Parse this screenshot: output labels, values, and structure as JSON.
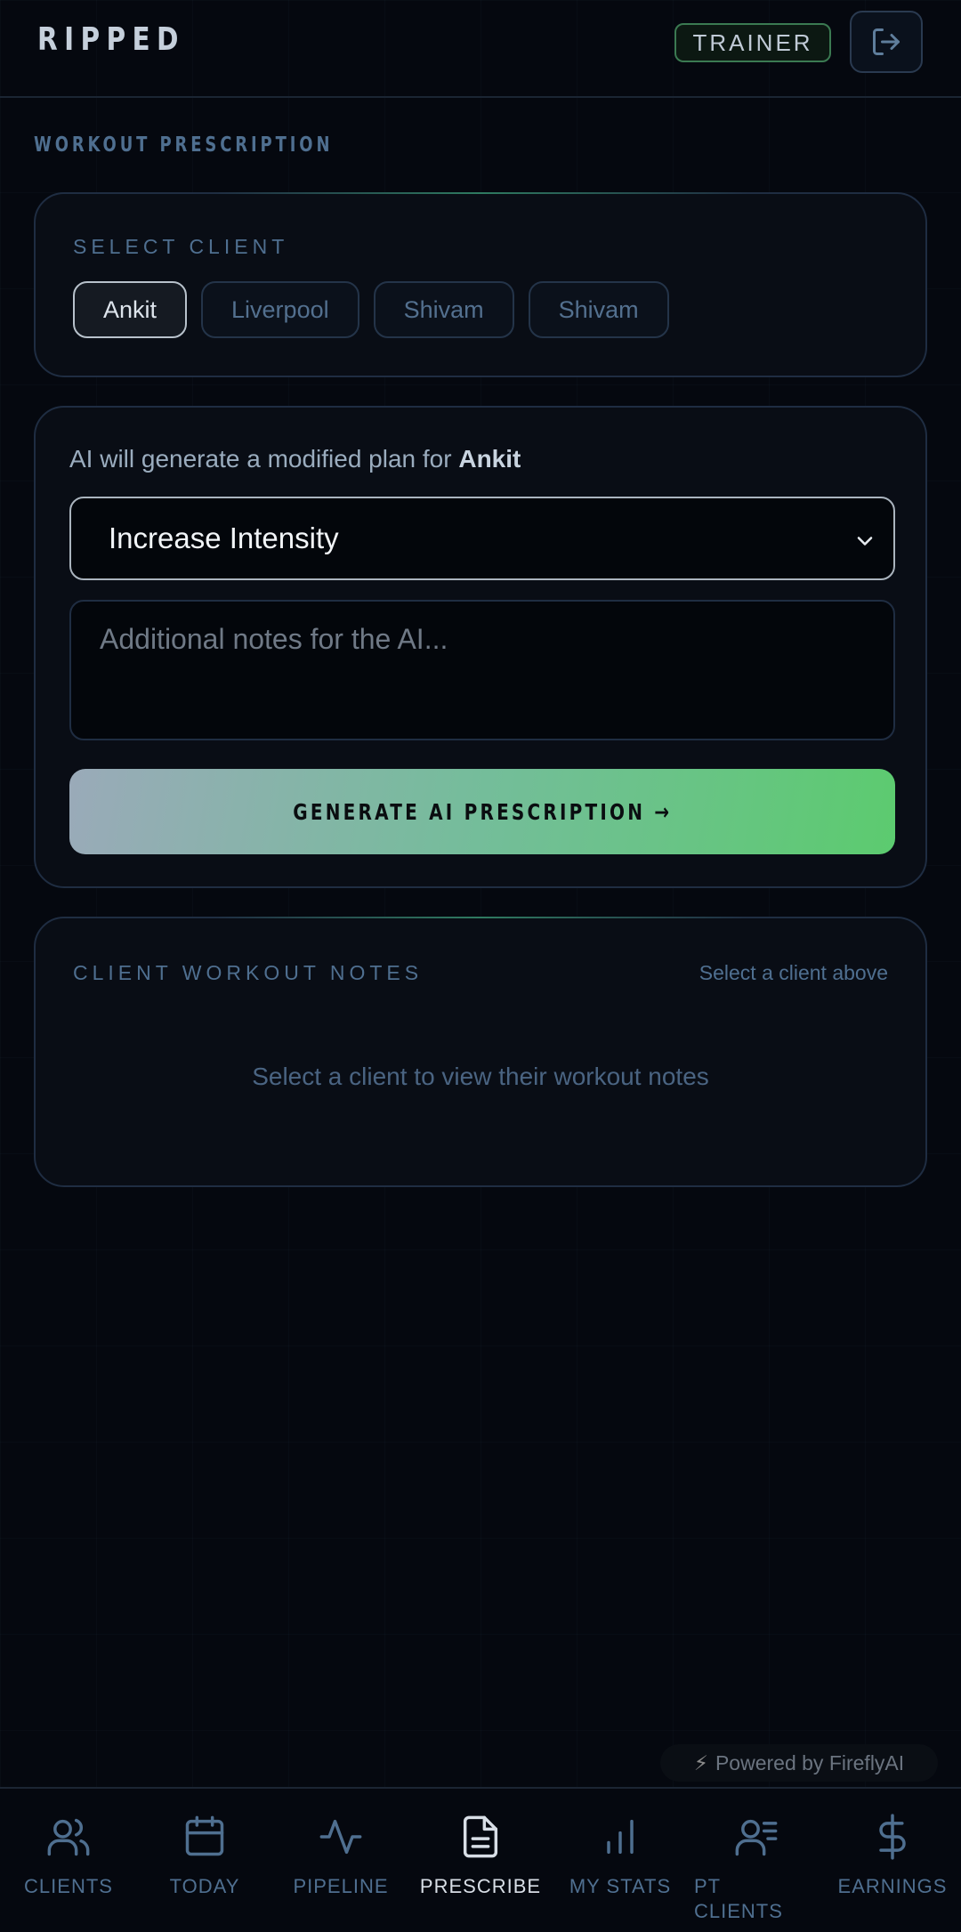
{
  "header": {
    "brand": "RIPPED",
    "role_badge": "TRAINER",
    "logout_icon": "logout-icon"
  },
  "page": {
    "section_title": "WORKOUT PRESCRIPTION"
  },
  "client_select": {
    "label": "SELECT CLIENT",
    "clients": [
      "Ankit",
      "Liverpool",
      "Shivam",
      "Shivam"
    ],
    "selected_index": 0
  },
  "prescription": {
    "ai_prefix": "AI will generate a modified plan for ",
    "client_name": "Ankit",
    "mode_value": "Increase Intensity",
    "notes_placeholder": "Additional notes for the AI...",
    "notes_value": "",
    "generate_label": "GENERATE AI PRESCRIPTION →"
  },
  "workout_notes": {
    "label": "CLIENT WORKOUT NOTES",
    "hint": "Select a client above",
    "empty_text": "Select a client to view their workout notes"
  },
  "powered_by": {
    "icon": "bolt-icon",
    "text": "Powered by FireflyAI"
  },
  "nav": {
    "active": "prescribe",
    "items": [
      {
        "id": "clients",
        "label": "CLIENTS",
        "icon": "users-icon"
      },
      {
        "id": "today",
        "label": "TODAY",
        "icon": "calendar-icon"
      },
      {
        "id": "pipeline",
        "label": "PIPELINE",
        "icon": "activity-icon"
      },
      {
        "id": "prescribe",
        "label": "PRESCRIBE",
        "icon": "file-text-icon"
      },
      {
        "id": "my-stats",
        "label": "MY STATS",
        "icon": "bar-chart-icon"
      },
      {
        "id": "pt-clients",
        "label": "PT CLIENTS",
        "icon": "user-list-icon"
      },
      {
        "id": "earnings",
        "label": "EARNINGS",
        "icon": "dollar-icon"
      }
    ]
  },
  "colors": {
    "background": "#05080f",
    "accent_green": "#5ccb6f",
    "muted_blue": "#4f6f90"
  }
}
